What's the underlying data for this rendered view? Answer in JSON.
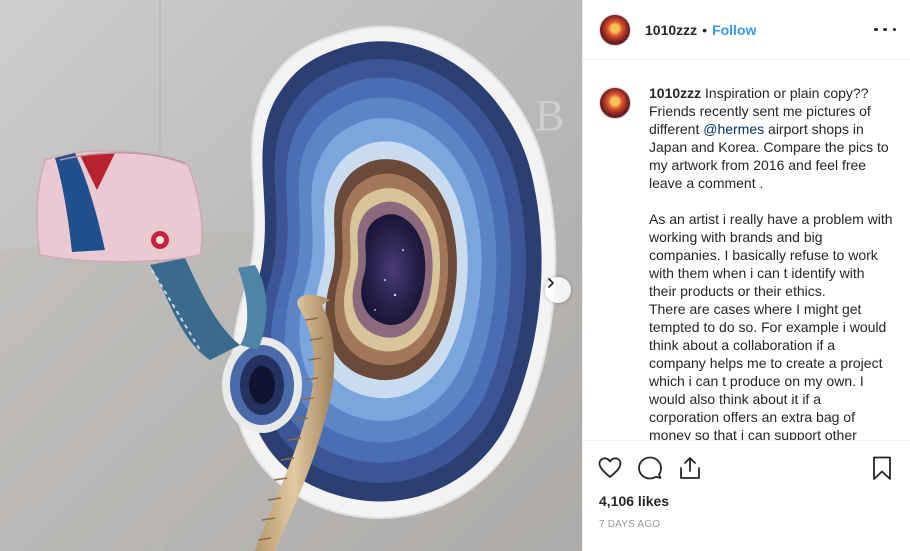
{
  "post": {
    "username": "1010zzz",
    "follow_label": "Follow",
    "separator": "•",
    "caption_user": "1010zzz",
    "caption_part1": " Inspiration or plain copy?? Friends recently sent me pictures of different ",
    "caption_mention": "@hermes",
    "caption_part2": " airport shops in Japan and Korea. Compare the pics to my artwork from 2016 and feel free leave a comment .\n\nAs an artist i really have a problem with working with brands and big companies. I basically refuse to work with them when i can t identify with their products or their ethics.\nThere are cases where I might get tempted to do so. For example i would think about a collaboration if a company helps me to create a project which i can t produce on my own. I would also think about it if a corporation offers an extra bag of money so that i can support other",
    "likes": "4,106 likes",
    "date": "7 DAYS AGO"
  },
  "icons": {
    "more": "more-options-icon",
    "like": "heart-icon",
    "comment": "comment-icon",
    "share": "share-icon",
    "save": "bookmark-icon",
    "next": "chevron-right-icon"
  },
  "colors": {
    "link": "#3897f0",
    "mention": "#003569",
    "text": "#262626",
    "muted": "#999999"
  }
}
